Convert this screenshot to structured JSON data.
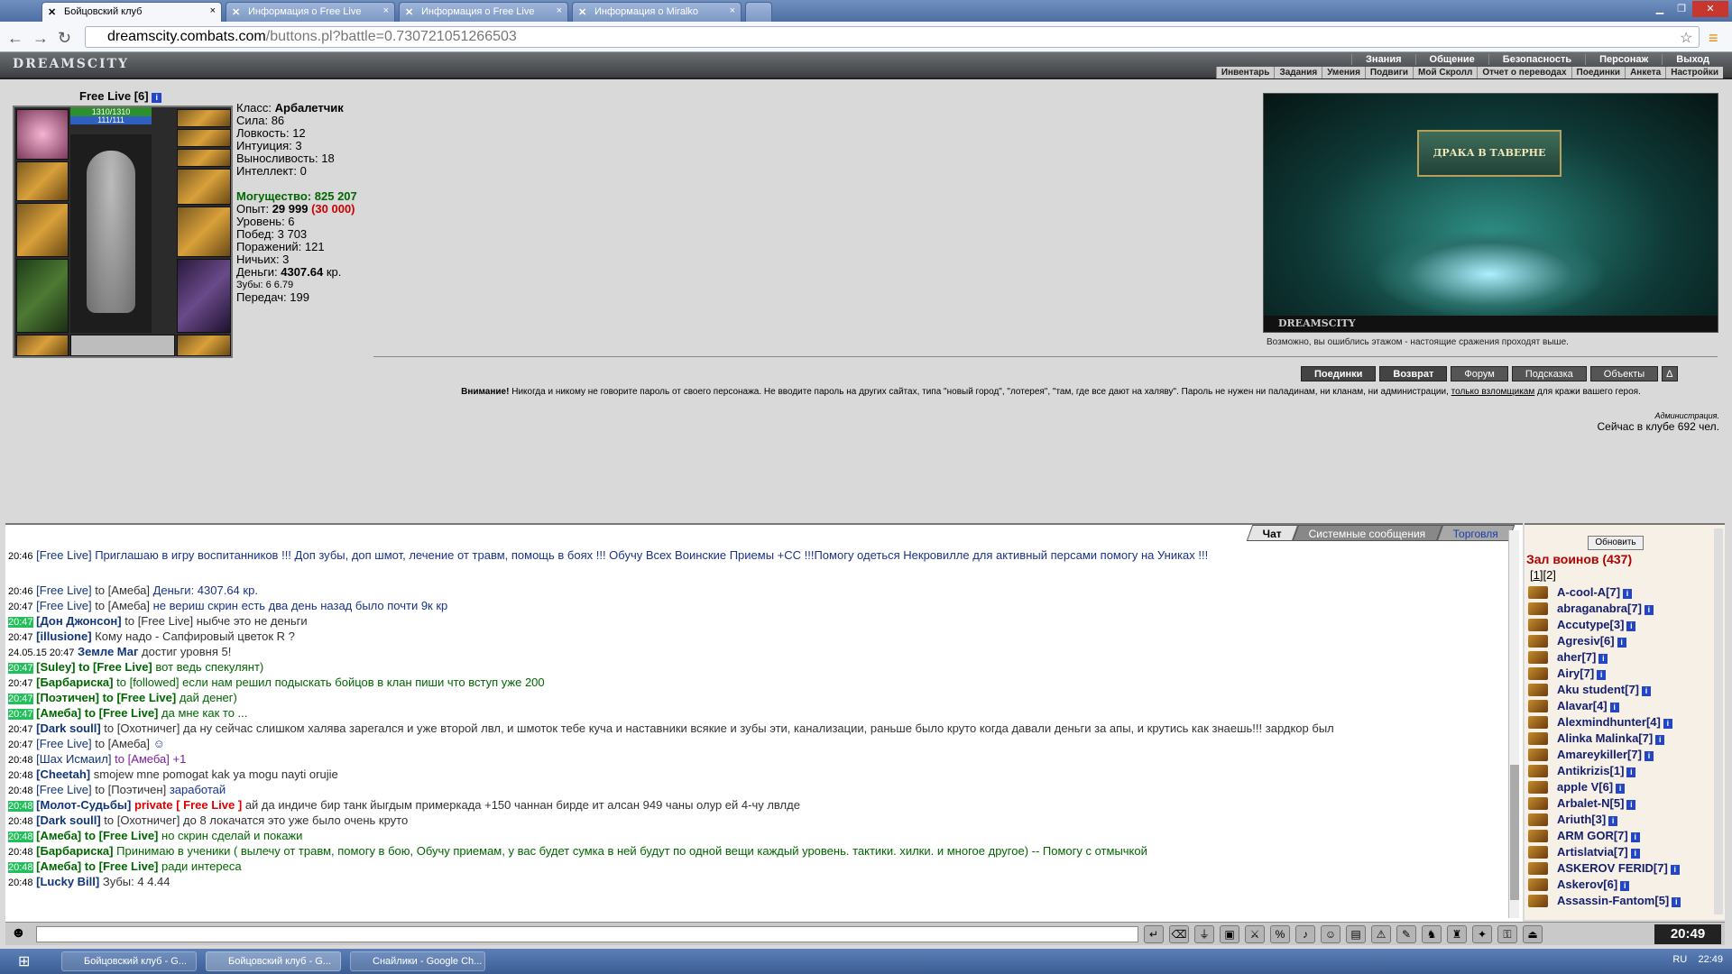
{
  "browser": {
    "tabs": [
      {
        "label": "Бойцовский клуб",
        "active": true
      },
      {
        "label": "Информация о Free Live",
        "active": false
      },
      {
        "label": "Информация о Free Live",
        "active": false
      },
      {
        "label": "Информация о Miralko",
        "active": false
      }
    ],
    "url_domain": "dreamscity.combats.com",
    "url_path": "/buttons.pl?battle=0.730721051266503"
  },
  "site": {
    "logo": "DREAMSCITY",
    "menu_top": [
      "Знания",
      "Общение",
      "Безопасность",
      "Персонаж",
      "Выход"
    ],
    "menu_sub": [
      "Инвентарь",
      "Задания",
      "Умения",
      "Подвиги",
      "Мой Скролл",
      "Отчет о переводах",
      "Поединки",
      "Анкета",
      "Настройки"
    ]
  },
  "character": {
    "name": "Free Live [6]",
    "hp": "1310/1310",
    "mana": "111/111",
    "stats": [
      {
        "label": "Класс:",
        "value": "Арбалетчик"
      },
      {
        "label": "Сила:",
        "value": "86"
      },
      {
        "label": "Ловкость:",
        "value": "12"
      },
      {
        "label": "Интуиция:",
        "value": "3"
      },
      {
        "label": "Выносливость:",
        "value": "18"
      },
      {
        "label": "Интеллект:",
        "value": "0"
      }
    ],
    "power_label": "Могущество:",
    "power_value": "825 207",
    "exp_label": "Опыт:",
    "exp_value": "29 999",
    "exp_next": "(30 000)",
    "level": "Уровень: 6",
    "wins": "Побед: 3 703",
    "losses": "Поражений: 121",
    "draws": "Ничьих: 3",
    "money_label": "Деньги:",
    "money_value": "4307.64",
    "money_unit": "кр.",
    "teeth": "Зубы: 6 6.79",
    "transfers": "Передач: 199"
  },
  "location": {
    "sign": "ДРАКА В ТАВЕРНЕ",
    "brand": "DREAMSCITY",
    "note": "Возможно, вы ошиблись этажом - настоящие сражения проходят выше."
  },
  "actions": [
    "Поединки",
    "Возврат",
    "Форум",
    "Подсказка",
    "Объекты",
    "Δ"
  ],
  "warning": {
    "bold": "Внимание!",
    "text": "Никогда и никому не говорите пароль от своего персонажа. Не вводите пароль на других сайтах, типа \"новый город\", \"лотерея\", \"там, где все дают на халяву\". Пароль не нужен ни паладинам, ни кланам, ни администрации,",
    "link": "только взломщикам",
    "tail": "для кражи вашего героя.",
    "sign": "Администрация.",
    "online": "Сейчас в клубе 692 чел."
  },
  "chat": {
    "tabs": [
      "Чат",
      "Системные сообщения",
      "Торговля"
    ],
    "lines": [
      {
        "time": "20:46",
        "who": "[Free Live]",
        "to": "",
        "text": "Приглашаю в игру воспитанников !!! Доп зубы, доп шмот, лечение от травм, помощь в боях !!! Обучу Всех Воинские Приемы +СС !!!Помогу одеться Некровилле для активный персами помогу на Униках !!!",
        "style": "blu",
        "green": false
      },
      {
        "time": "20:46",
        "who": "[Free Live]",
        "to": "to [Амеба]",
        "text": "Деньги: 4307.64 кр.",
        "style": "blu",
        "green": false
      },
      {
        "time": "20:47",
        "who": "[Free Live]",
        "to": "to [Амеба]",
        "text": "не вериш скрин есть два день назад было почти 9к кр",
        "style": "blu",
        "green": false
      },
      {
        "time": "20:47",
        "who": "[Дон Джонсон]",
        "to": "to [Free Live]",
        "text": "ныбче это не деньги",
        "style": "dk",
        "green": true
      },
      {
        "time": "20:47",
        "who": "[illusione]",
        "to": "",
        "text": "Кому надо - Сапфировый цветок R ?",
        "style": "dk",
        "green": false
      },
      {
        "time": "24.05.15 20:47",
        "who": "Земле Маг",
        "to": "",
        "text": "достиг уровня 5!",
        "style": "dk",
        "green": false
      },
      {
        "time": "20:47",
        "who": "[Suley]",
        "to": "to [Free Live]",
        "text": "вот ведь спекулянт)",
        "style": "grn",
        "green": true
      },
      {
        "time": "20:47",
        "who": "[Барбариска]",
        "to": "to [followed]",
        "text": "если нам решил подыскать бойцов в клан пиши что вступ уже 200",
        "style": "grn",
        "green": false
      },
      {
        "time": "20:47",
        "who": "[Поэтичен]",
        "to": "to [Free Live]",
        "text": "дай денег)",
        "style": "grn",
        "green": true
      },
      {
        "time": "20:47",
        "who": "[Амеба]",
        "to": "to [Free Live]",
        "text": "да мне как то ...",
        "style": "grn",
        "green": true
      },
      {
        "time": "20:47",
        "who": "[Dark soull]",
        "to": "to [Охотничег]",
        "text": "да ну сейчас слишком халява зарегался и уже второй лвл, и шмоток тебе куча и наставники всякие и зубы эти, канализации, раньше было круто когда давали деньги за апы, и крутись как знаешь!!! зардкор был",
        "style": "dk",
        "green": false
      },
      {
        "time": "20:47",
        "who": "[Free Live]",
        "to": "to [Амеба]",
        "text": "☺",
        "style": "blu",
        "green": false
      },
      {
        "time": "20:48",
        "who": "[Шах Исмаил]",
        "to": "to [Амеба]",
        "text": "+1",
        "style": "pur",
        "green": false
      },
      {
        "time": "20:48",
        "who": "[Cheetah]",
        "to": "",
        "text": "smojew mne pomogat kak ya mogu nayti orujie",
        "style": "dk",
        "green": false
      },
      {
        "time": "20:48",
        "who": "[Free Live]",
        "to": "to [Поэтичен]",
        "text": "заработай",
        "style": "blu",
        "green": false
      },
      {
        "time": "20:48",
        "who": "[Молот-Судьбы]",
        "to": "private [ Free Live ]",
        "text": "ай да индиче бир танк йыгдым примеркада +150 чаннан бирде ит алсан 949 чаны олур ей 4-чу лвлде",
        "style": "dk",
        "green": true
      },
      {
        "time": "20:48",
        "who": "[Dark soull]",
        "to": "to [Охотничег]",
        "text": "до 8 локачатся это уже было очень круто",
        "style": "dk",
        "green": false
      },
      {
        "time": "20:48",
        "who": "[Амеба]",
        "to": "to [Free Live]",
        "text": "но скрин сделай и покажи",
        "style": "grn",
        "green": true
      },
      {
        "time": "20:48",
        "who": "[Барбариска]",
        "to": "",
        "text": "Принимаю в ученики ( вылечу от травм, помогу в бою, Обучу приемам, у вас будет сумка в ней будут по одной вещи каждый уровень. тактики. хилки. и многое другое) -- Помогу с отмычкой",
        "style": "grn",
        "green": false
      },
      {
        "time": "20:48",
        "who": "[Амеба]",
        "to": "to [Free Live]",
        "text": "ради интереса",
        "style": "grn",
        "green": true
      },
      {
        "time": "20:48",
        "who": "[Lucky Bill]",
        "to": "",
        "text": "Зубы: 4 4.44",
        "style": "dk",
        "green": false
      }
    ]
  },
  "online_list": {
    "refresh": "Обновить",
    "title": "Зал воинов (437)",
    "pages": [
      "[1]",
      "[2]"
    ],
    "users": [
      "A-cool-A[7]",
      "abraganabra[7]",
      "Accutype[3]",
      "Agresiv[6]",
      "aher[7]",
      "Airy[7]",
      "Aku student[7]",
      "Alavar[4]",
      "Alexmindhunter[4]",
      "Alinka Malinka[7]",
      "Amareykiller[7]",
      "Antikrizis[1]",
      "apple V[6]",
      "Arbalet-N[5]",
      "Ariuth[3]",
      "ARM GOR[7]",
      "Artislatvia[7]",
      "ASKEROV FERID[7]",
      "Askerov[6]",
      "Assassin-Fantom[5]"
    ]
  },
  "toolbar": {
    "clock": "20:49"
  },
  "taskbar": {
    "items": [
      "Бойцовский клуб - G...",
      "Бойцовский клуб - G...",
      "Снайлики - Google Ch..."
    ],
    "lang": "RU",
    "time": "22:49"
  }
}
